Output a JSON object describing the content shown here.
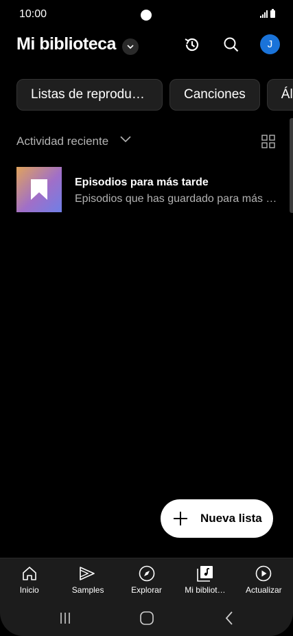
{
  "status_bar": {
    "time": "10:00"
  },
  "header": {
    "title": "Mi biblioteca",
    "avatar_initial": "J",
    "icons": [
      "history-icon",
      "search-icon"
    ]
  },
  "chips": [
    {
      "label": "Listas de reproducción"
    },
    {
      "label": "Canciones"
    },
    {
      "label": "Álbumes"
    }
  ],
  "sort": {
    "label": "Actividad reciente"
  },
  "items": [
    {
      "title": "Episodios para más tarde",
      "subtitle": "Episodios que has guardado para más tarde"
    }
  ],
  "fab": {
    "label": "Nueva lista"
  },
  "bottom_nav": [
    {
      "label": "Inicio",
      "icon": "home-icon"
    },
    {
      "label": "Samples",
      "icon": "samples-icon"
    },
    {
      "label": "Explorar",
      "icon": "compass-icon"
    },
    {
      "label": "Mi bibliot…",
      "icon": "library-icon"
    },
    {
      "label": "Actualizar",
      "icon": "upgrade-icon"
    }
  ],
  "colors": {
    "background": "#000000",
    "chip_bg": "#1f1f1f",
    "avatar": "#1a73d9",
    "secondary_text": "#b3b3b3"
  }
}
